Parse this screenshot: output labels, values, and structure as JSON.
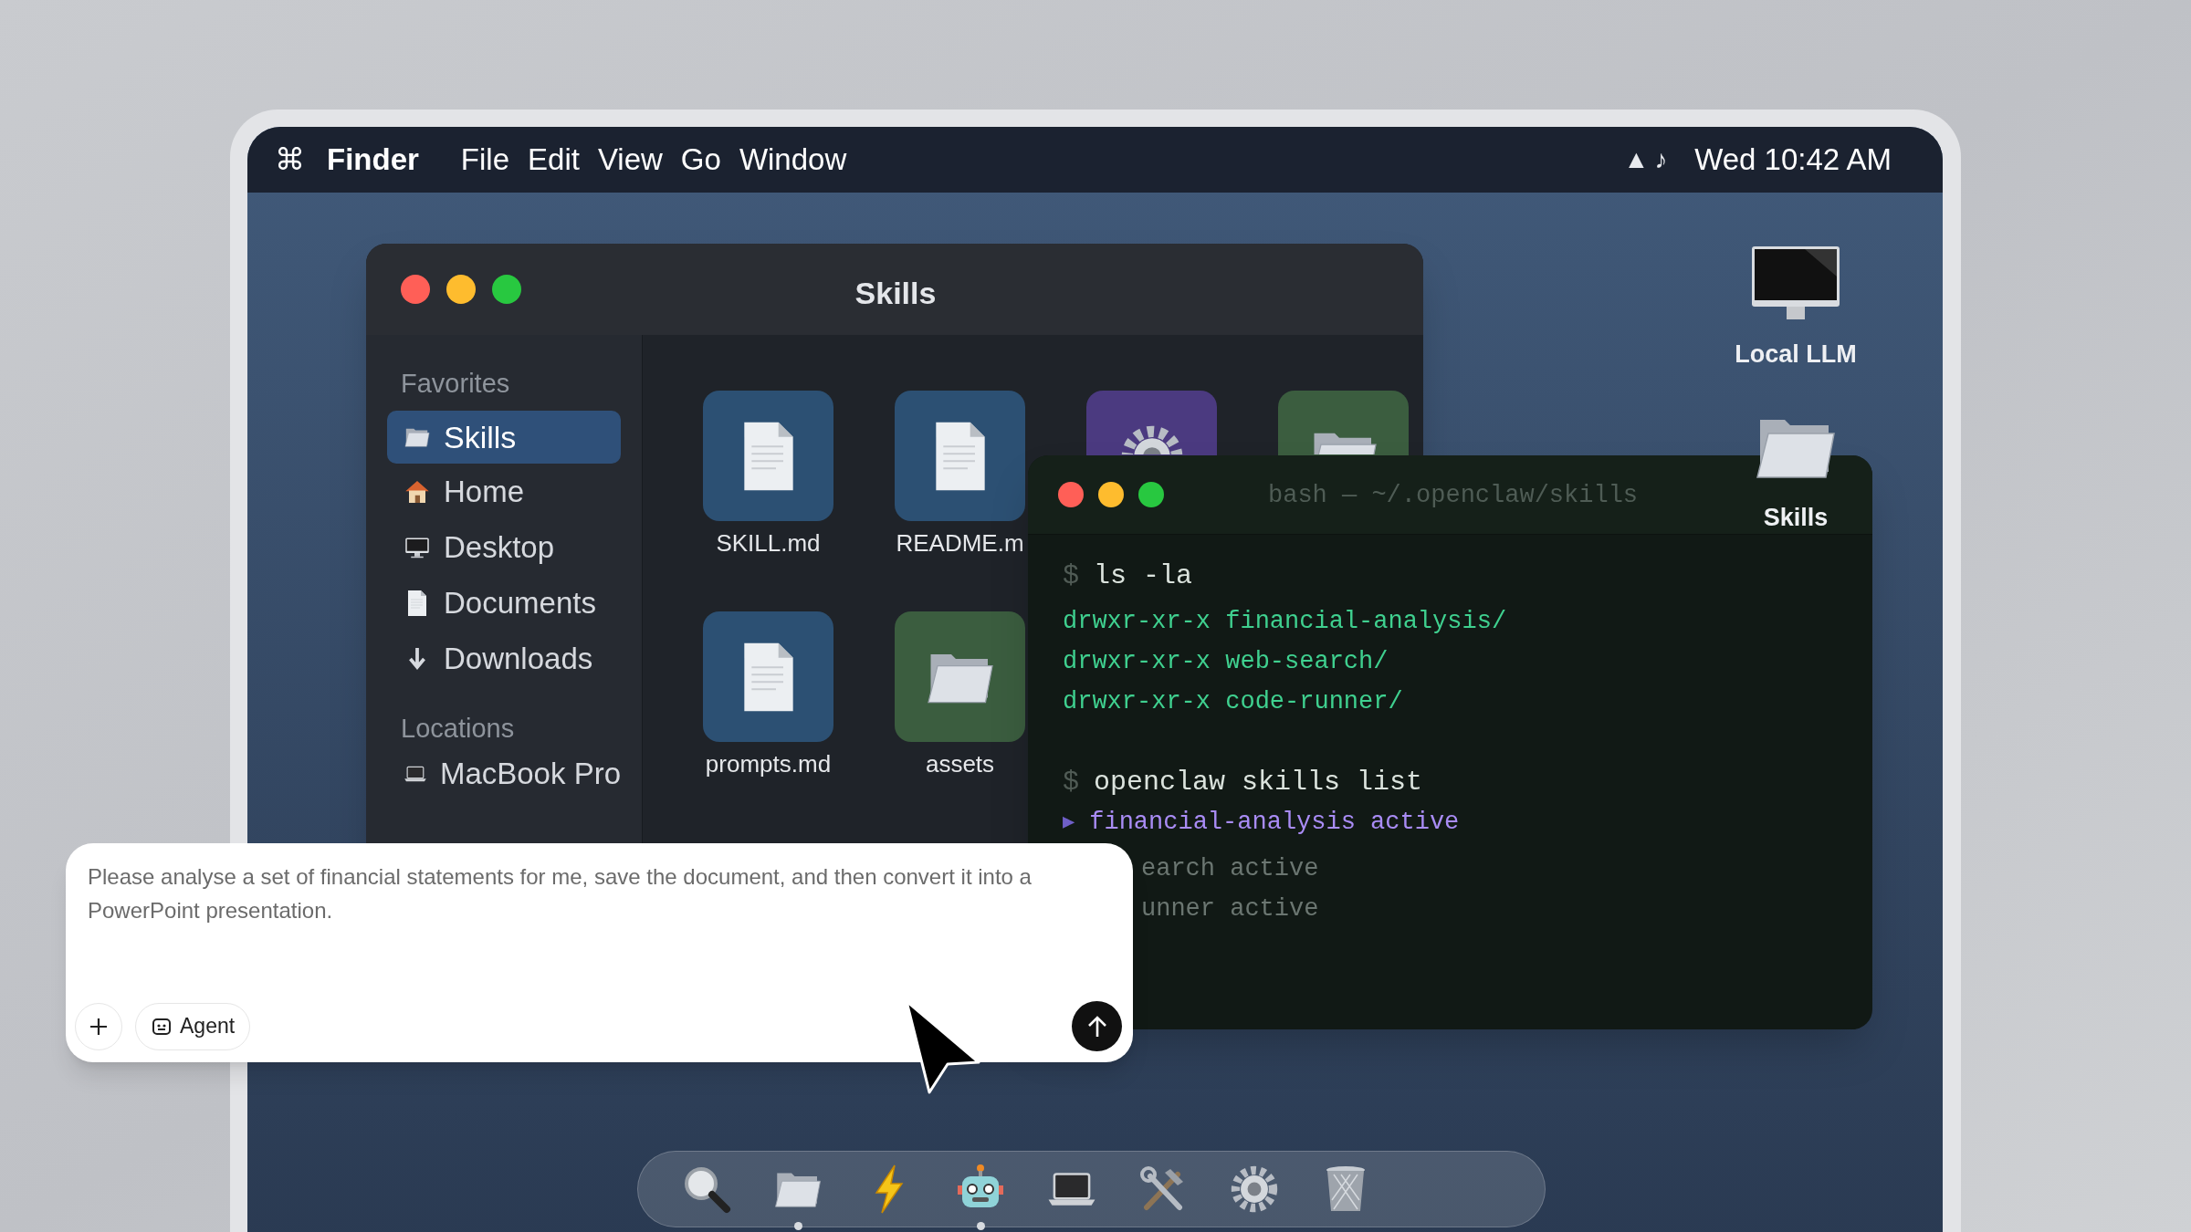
{
  "menu_bar": {
    "apple": "⌘",
    "app": "Finder",
    "menus": [
      "File",
      "Edit",
      "View",
      "Go",
      "Window"
    ],
    "status_glyphs": [
      "▲",
      "♪"
    ],
    "clock": "Wed 10:42 AM"
  },
  "finder": {
    "title": "Skills",
    "sidebar": [
      {
        "kind": "heading",
        "label": "Favorites"
      },
      {
        "kind": "folder",
        "label": "Skills",
        "selected": true
      },
      {
        "kind": "home",
        "label": "Home",
        "selected": false
      },
      {
        "kind": "desktop",
        "label": "Desktop",
        "selected": false
      },
      {
        "kind": "document",
        "label": "Documents",
        "selected": false
      },
      {
        "kind": "download",
        "label": "Downloads",
        "selected": false
      },
      {
        "kind": "heading",
        "label": "Locations"
      },
      {
        "kind": "laptop",
        "label": "MacBook Pro",
        "selected": false
      }
    ],
    "files": [
      {
        "kind": "document",
        "label": "SKILL.md"
      },
      {
        "kind": "document",
        "label": "README.m"
      },
      {
        "kind": "settings"
      },
      {
        "kind": "folder"
      },
      {
        "kind": "document",
        "label": "prompts.md"
      },
      {
        "kind": "folder",
        "label": "assets"
      }
    ]
  },
  "terminal": {
    "title": "bash — ~/.openclaw/skills",
    "lines": [
      {
        "kind": "command",
        "prompt": "$",
        "text": "ls -la"
      },
      {
        "kind": "output",
        "text": "drwxr-xr-x financial-analysis/"
      },
      {
        "kind": "output",
        "text": "drwxr-xr-x web-search/"
      },
      {
        "kind": "output",
        "text": "drwxr-xr-x code-runner/"
      },
      {
        "kind": "command",
        "prompt": "$",
        "text": "openclaw skills list"
      },
      {
        "kind": "highlight",
        "marker": "▶",
        "text": "financial-analysis active"
      },
      {
        "kind": "partial",
        "text": "earch active"
      },
      {
        "kind": "partial",
        "text": "unner active"
      }
    ]
  },
  "desktop_icons": [
    {
      "kind": "monitor",
      "label": "Local LLM"
    },
    {
      "kind": "folder",
      "label": "Skills"
    }
  ],
  "chat": {
    "text": "Please analyse a set of financial statements for me, save the document, and then convert it into a PowerPoint presentation.",
    "mode": "Agent"
  },
  "dock": {
    "items": [
      {
        "kind": "search",
        "running": false
      },
      {
        "kind": "folder",
        "running": true
      },
      {
        "kind": "bolt",
        "running": false
      },
      {
        "kind": "robot",
        "running": true
      },
      {
        "kind": "laptop",
        "running": false
      },
      {
        "kind": "tools",
        "running": false
      },
      {
        "kind": "gear",
        "running": false
      },
      {
        "kind": "trash",
        "running": false
      }
    ]
  }
}
